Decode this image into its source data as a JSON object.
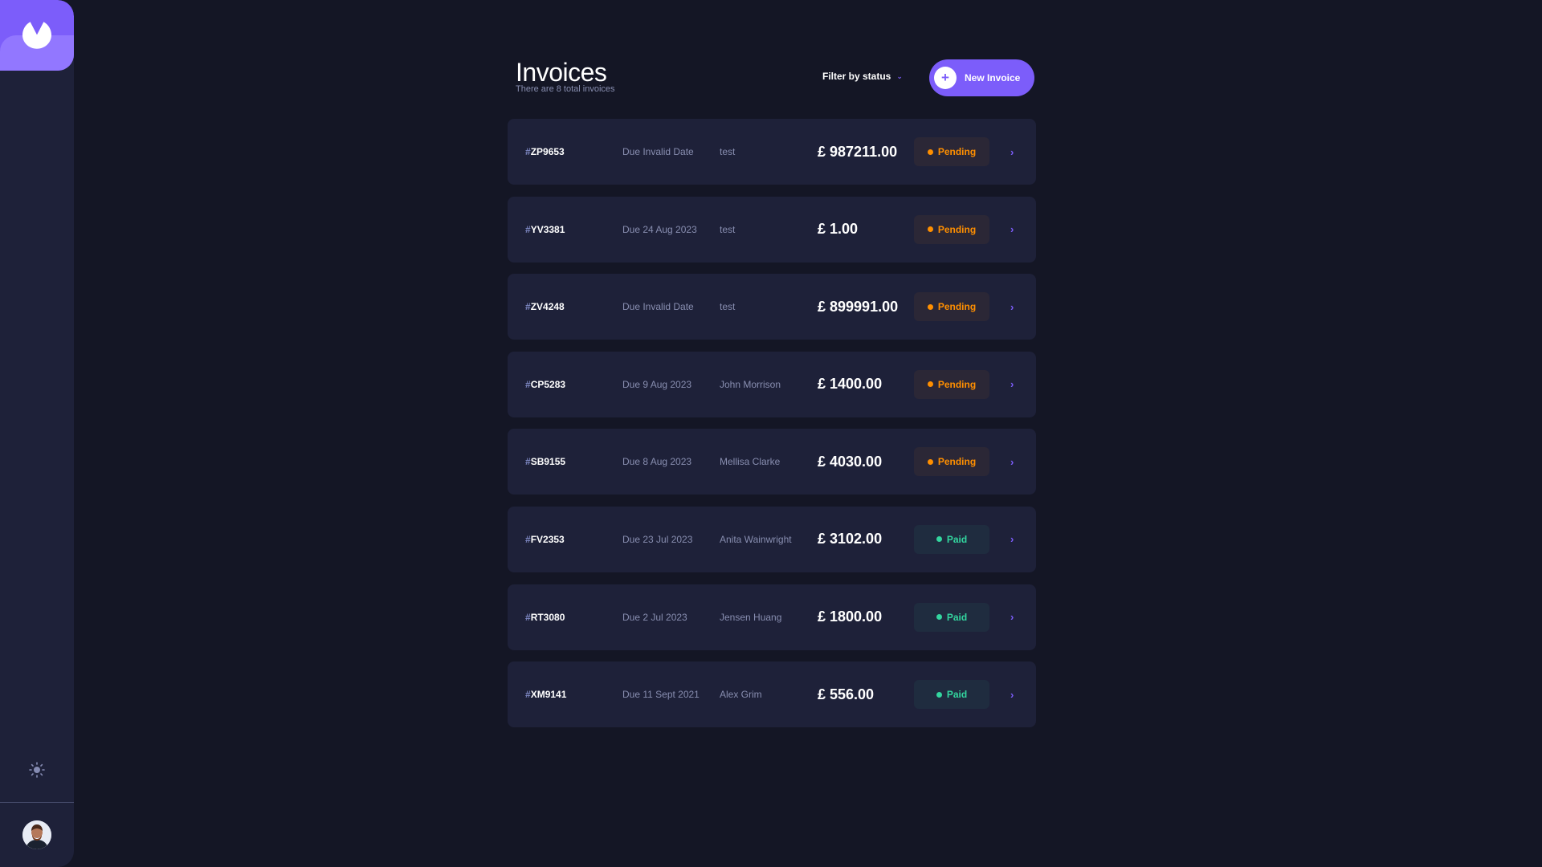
{
  "sidebar": {
    "logo_icon": "logo-icon",
    "theme_icon": "sun-icon",
    "avatar_icon": "user-avatar"
  },
  "header": {
    "title": "Invoices",
    "subtitle": "There are 8 total invoices",
    "filter_label": "Filter by status",
    "new_invoice_label": "New Invoice",
    "new_invoice_icon": "+"
  },
  "invoices": [
    {
      "id": "ZP9653",
      "due": "Due Invalid Date",
      "client": "test",
      "amount": "£ 987211.00",
      "status": "Pending"
    },
    {
      "id": "YV3381",
      "due": "Due 24 Aug 2023",
      "client": "test",
      "amount": "£ 1.00",
      "status": "Pending"
    },
    {
      "id": "ZV4248",
      "due": "Due Invalid Date",
      "client": "test",
      "amount": "£ 899991.00",
      "status": "Pending"
    },
    {
      "id": "CP5283",
      "due": "Due 9 Aug 2023",
      "client": "John Morrison",
      "amount": "£ 1400.00",
      "status": "Pending"
    },
    {
      "id": "SB9155",
      "due": "Due 8 Aug 2023",
      "client": "Mellisa Clarke",
      "amount": "£ 4030.00",
      "status": "Pending"
    },
    {
      "id": "FV2353",
      "due": "Due 23 Jul 2023",
      "client": "Anita Wainwright",
      "amount": "£ 3102.00",
      "status": "Paid"
    },
    {
      "id": "RT3080",
      "due": "Due 2 Jul 2023",
      "client": "Jensen Huang",
      "amount": "£ 1800.00",
      "status": "Paid"
    },
    {
      "id": "XM9141",
      "due": "Due 11 Sept 2021",
      "client": "Alex Grim",
      "amount": "£ 556.00",
      "status": "Paid"
    }
  ],
  "colors": {
    "background": "#141625",
    "surface": "#1e2139",
    "accent": "#7c5dfa",
    "pending": "#ff8f00",
    "paid": "#33d69f"
  }
}
